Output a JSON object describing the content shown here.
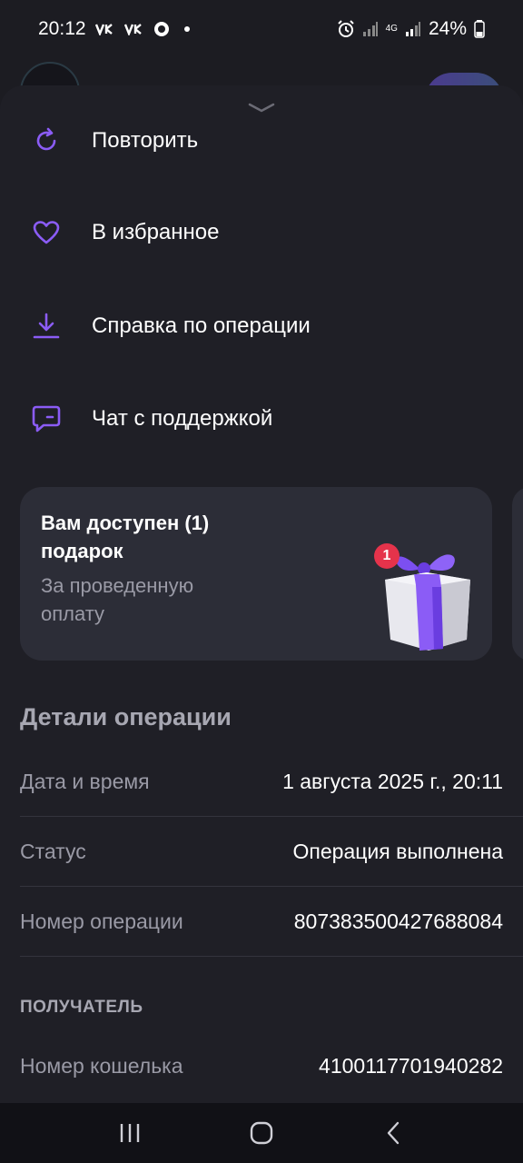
{
  "status_bar": {
    "time": "20:12",
    "battery": "24%",
    "network": "4G",
    "icons": [
      "vk-icon",
      "vk-icon",
      "messenger-icon",
      "notification-dot",
      "alarm-icon",
      "signal-icon",
      "signal-icon",
      "battery-icon"
    ]
  },
  "sheet": {
    "menu": [
      {
        "label": "Повторить",
        "icon": "repeat-icon"
      },
      {
        "label": "В избранное",
        "icon": "heart-icon"
      },
      {
        "label": "Справка по операции",
        "icon": "download-icon"
      },
      {
        "label": "Чат с поддержкой",
        "icon": "chat-icon"
      }
    ],
    "gift_card": {
      "title": "Вам доступен (1) подарок",
      "subtitle": "За проведенную оплату",
      "badge": "1",
      "icon": "gift-icon"
    },
    "details": {
      "title": "Детали операции",
      "rows": [
        {
          "label": "Дата и время",
          "value": "1 августа 2025 г., 20:11"
        },
        {
          "label": "Статус",
          "value": "Операция выполнена"
        },
        {
          "label": "Номер операции",
          "value": "807383500427688084"
        }
      ],
      "recipient_heading": "ПОЛУЧАТЕЛЬ",
      "recipient_rows": [
        {
          "label": "Номер кошелька",
          "value": "4100117701940282"
        }
      ]
    }
  },
  "nav_bar": {
    "icons": [
      "recent-apps-icon",
      "home-icon",
      "back-icon"
    ]
  },
  "colors": {
    "accent": "#8b5cf6",
    "sheet_bg": "#1f1f26",
    "card_bg": "#2c2d37",
    "muted_text": "#9a9aa6",
    "badge": "#e5334b"
  }
}
